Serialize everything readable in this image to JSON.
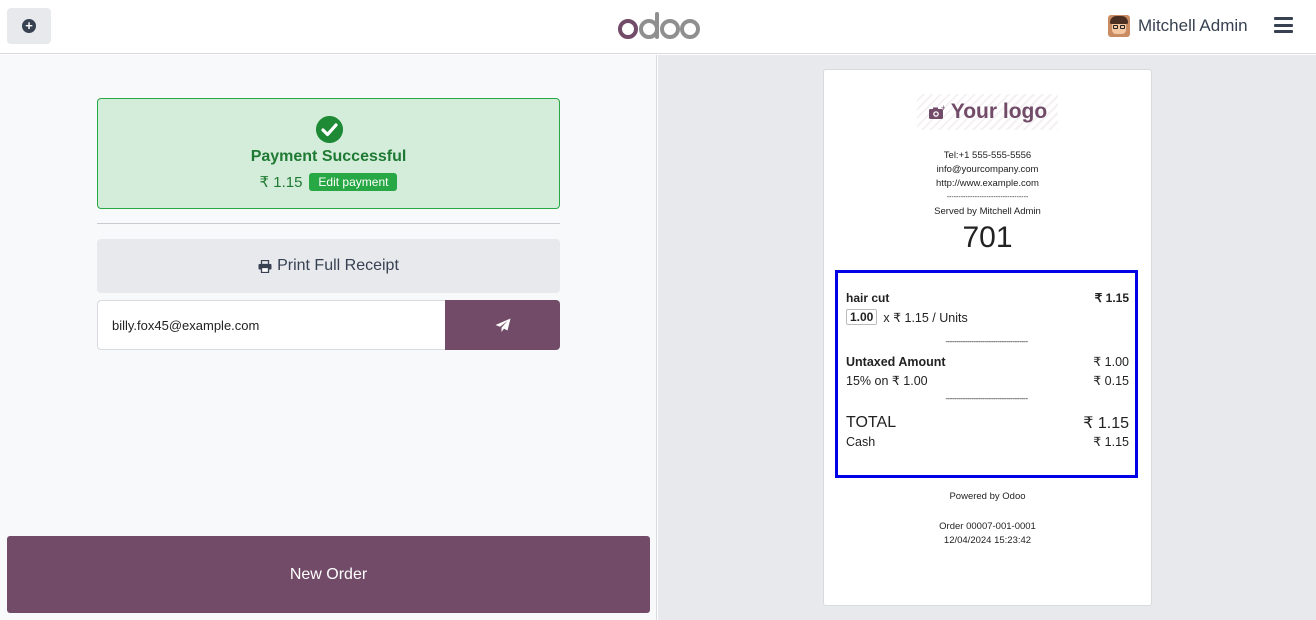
{
  "header": {
    "logo_text": "odoo",
    "user_name": "Mitchell Admin"
  },
  "payment": {
    "title": "Payment Successful",
    "amount": "₹ 1.15",
    "edit_label": "Edit payment"
  },
  "actions": {
    "print_label": "Print Full Receipt",
    "email_value": "billy.fox45@example.com",
    "new_order_label": "New Order"
  },
  "receipt": {
    "logo_text": "Your logo",
    "tel": "Tel:+1 555-555-5556",
    "email": "info@yourcompany.com",
    "website": "http://www.example.com",
    "separator": "-----------------------------------",
    "served_by": "Served by Mitchell Admin",
    "order_number": "701",
    "line": {
      "product": "hair cut",
      "price": "₹ 1.15",
      "qty": "1.00",
      "unit_price": "x ₹ 1.15 / Units"
    },
    "dash_line": "--------------------------------------",
    "untaxed_label": "Untaxed Amount",
    "untaxed_value": "₹ 1.00",
    "tax_label": "15% on ₹ 1.00",
    "tax_value": "₹ 0.15",
    "total_label": "TOTAL",
    "total_value": "₹ 1.15",
    "cash_label": "Cash",
    "cash_value": "₹ 1.15",
    "powered_by": "Powered by Odoo",
    "order_ref": "Order 00007-001-0001",
    "datetime": "12/04/2024 15:23:42"
  }
}
